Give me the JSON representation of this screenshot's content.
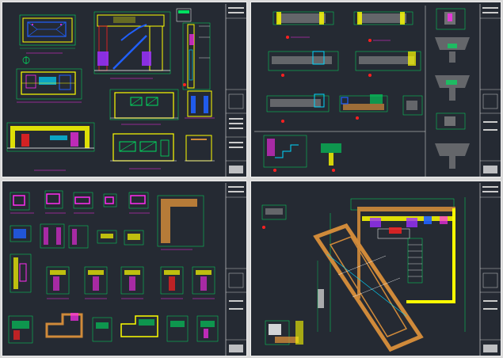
{
  "colors": {
    "background": "#252a33",
    "frame": "#f0f0f0",
    "wall": "#ffff00",
    "timber": "#d08a3a",
    "dimension": "#00e060",
    "cyan": "#00d8ff",
    "magenta": "#ff2cf0",
    "blue": "#2060ff",
    "red": "#ff2020",
    "white": "#ffffff"
  },
  "sheets": [
    {
      "id": "sheet-1",
      "content": "plans-sections-elevations"
    },
    {
      "id": "sheet-2",
      "content": "wall-and-stair-details"
    },
    {
      "id": "sheet-3",
      "content": "window-door-details"
    },
    {
      "id": "sheet-4",
      "content": "ground-floor-plan"
    }
  ],
  "icons": {
    "title-block": "title-block-icon",
    "north": "north-arrow-icon"
  }
}
